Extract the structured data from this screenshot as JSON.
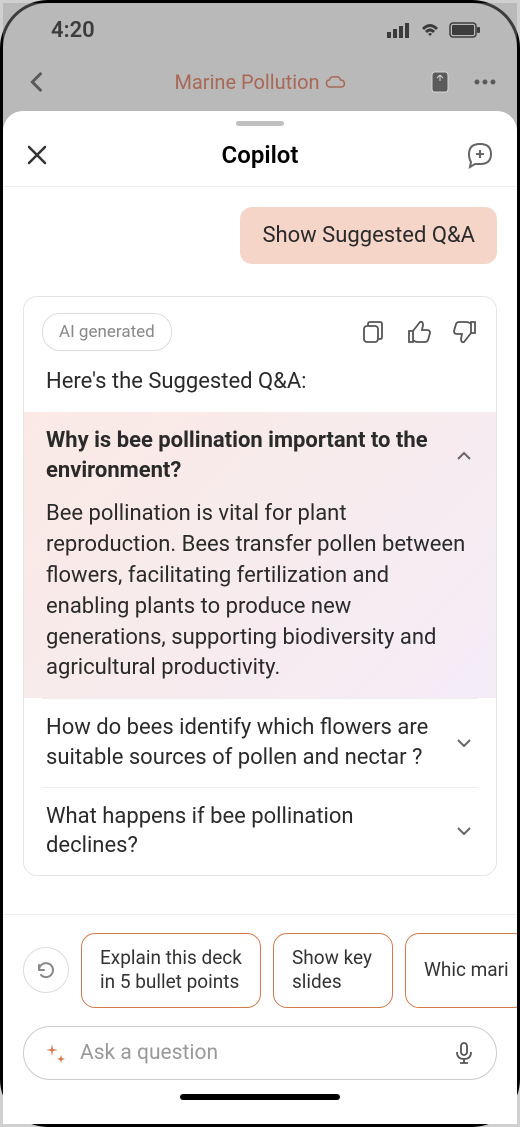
{
  "status": {
    "time": "4:20"
  },
  "app": {
    "title": "Marine Pollution"
  },
  "sheet": {
    "title": "Copilot",
    "user_message": "Show Suggested Q&A",
    "ai_badge": "AI generated",
    "intro": "Here's the Suggested Q&A:",
    "qa": [
      {
        "question": "Why is bee pollination important to the environment?",
        "answer": "Bee pollination is vital for plant reproduction. Bees transfer pollen between flowers, facilitating fertilization and enabling plants to produce new generations, supporting biodiversity and agricultural productivity."
      },
      {
        "question": "How do bees identify which flowers are suitable sources of pollen and nectar ?"
      },
      {
        "question": "What happens if bee pollination declines?"
      }
    ],
    "suggestions": [
      "Explain this deck in 5 bullet points",
      "Show key slides",
      "Whic mari"
    ],
    "input_placeholder": "Ask a question"
  }
}
